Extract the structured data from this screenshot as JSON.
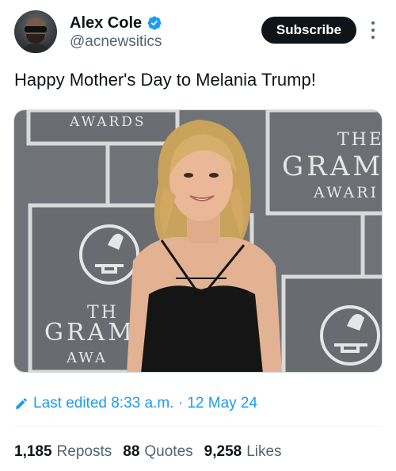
{
  "author": {
    "display_name": "Alex Cole",
    "handle": "@acnewsitics",
    "verified_icon": "verified-badge-icon",
    "avatar_alt": "profile picture"
  },
  "header": {
    "subscribe_label": "Subscribe",
    "more_icon": "more-vertical-icon"
  },
  "tweet": {
    "text": "Happy Mother's Day to Melania Trump!"
  },
  "media": {
    "backdrop_text": {
      "awards_banner": "AWARDS",
      "right_line1": "THE",
      "right_line2": "GRAM",
      "right_line3": "AWARI",
      "left_line1": "TH",
      "left_line2": "GRAM",
      "left_line3": "AWA"
    }
  },
  "meta": {
    "edited_text": "Last edited 8:33 a.m. · 12 May 24",
    "edit_icon": "pencil-icon"
  },
  "stats": [
    {
      "num": "1,185",
      "label": "Reposts"
    },
    {
      "num": "88",
      "label": "Quotes"
    },
    {
      "num": "9,258",
      "label": "Likes"
    }
  ],
  "colors": {
    "accent": "#1d9bf0",
    "text": "#0f1419",
    "secondary": "#536471",
    "backdrop": "#6f7378"
  }
}
